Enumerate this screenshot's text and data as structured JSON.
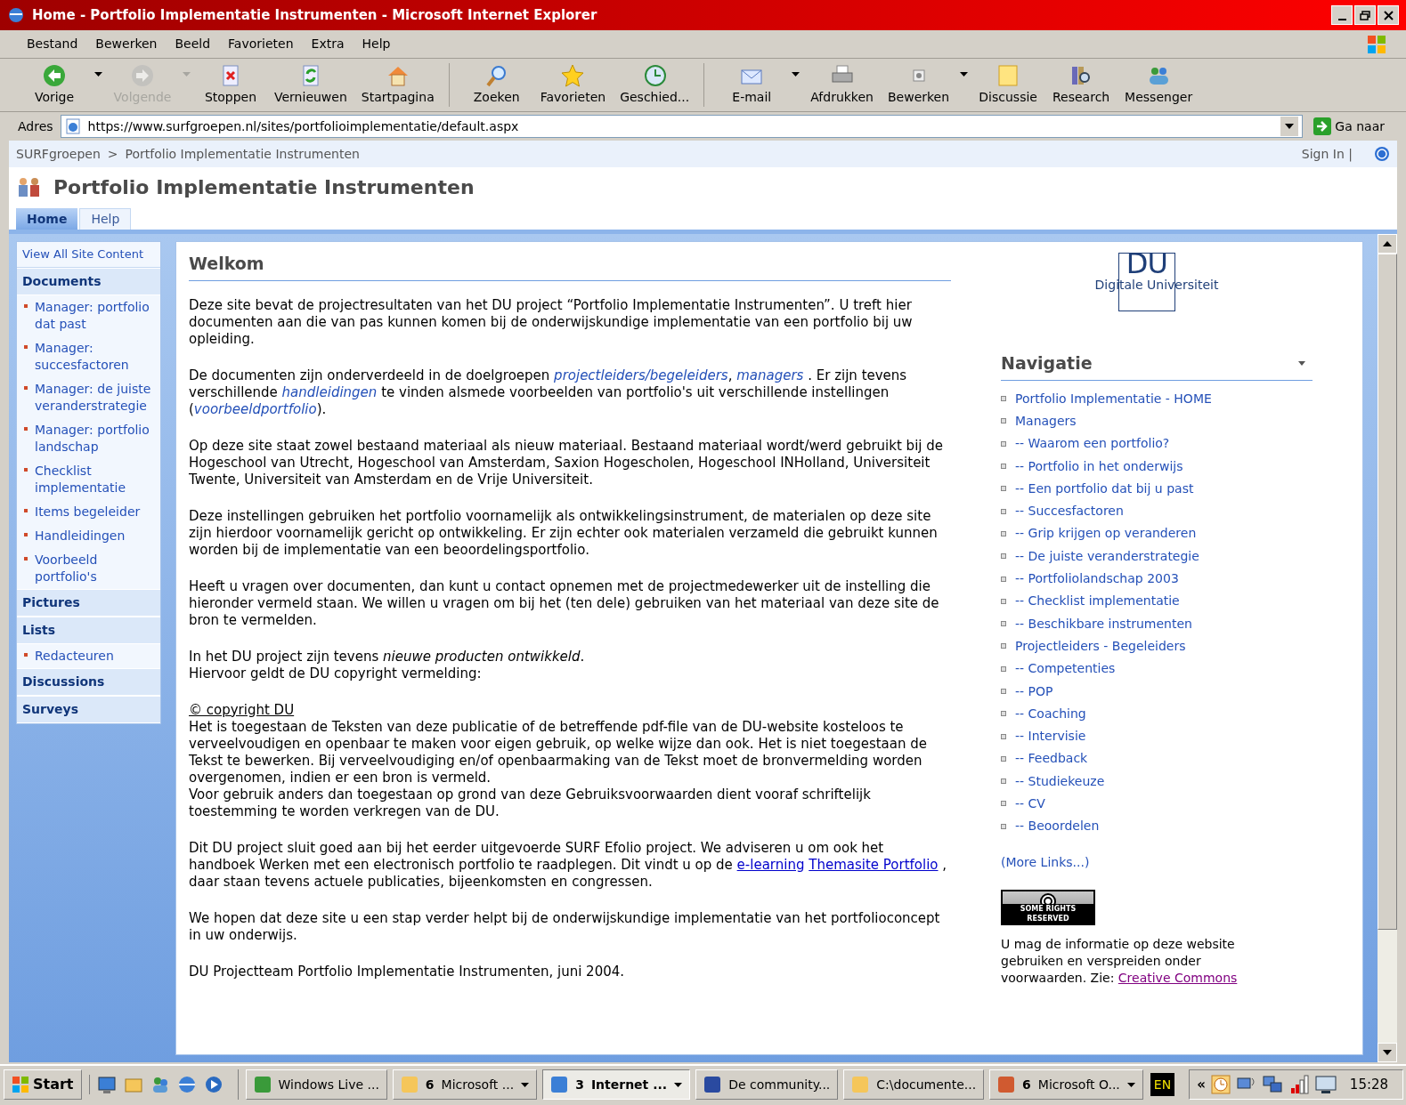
{
  "window": {
    "title": "Home - Portfolio Implementatie Instrumenten - Microsoft Internet Explorer"
  },
  "menu": [
    "Bestand",
    "Bewerken",
    "Beeld",
    "Favorieten",
    "Extra",
    "Help"
  ],
  "toolbar": [
    {
      "label": "Vorige",
      "disabled": false,
      "dropdown": true
    },
    {
      "label": "Volgende",
      "disabled": true,
      "dropdown": true
    },
    {
      "label": "Stoppen",
      "disabled": false,
      "dropdown": false
    },
    {
      "label": "Vernieuwen",
      "disabled": false,
      "dropdown": false
    },
    {
      "label": "Startpagina",
      "disabled": false,
      "dropdown": false
    },
    {
      "label": "Zoeken",
      "disabled": false,
      "dropdown": false
    },
    {
      "label": "Favorieten",
      "disabled": false,
      "dropdown": false
    },
    {
      "label": "Geschied...",
      "disabled": false,
      "dropdown": false
    },
    {
      "label": "E-mail",
      "disabled": false,
      "dropdown": true
    },
    {
      "label": "Afdrukken",
      "disabled": false,
      "dropdown": false
    },
    {
      "label": "Bewerken",
      "disabled": false,
      "dropdown": true
    },
    {
      "label": "Discussie",
      "disabled": false,
      "dropdown": false
    },
    {
      "label": "Research",
      "disabled": false,
      "dropdown": false
    },
    {
      "label": "Messenger",
      "disabled": false,
      "dropdown": false
    }
  ],
  "address": {
    "label": "Adres",
    "value": "https://www.surfgroepen.nl/sites/portfolioimplementatie/default.aspx",
    "go": "Ga naar"
  },
  "site": {
    "breadcrumb": [
      "SURFgroepen",
      ">",
      "Portfolio Implementatie Instrumenten"
    ],
    "sign_in": "Sign In |",
    "title": "Portfolio Implementatie Instrumenten",
    "tabs": [
      {
        "label": "Home",
        "selected": true
      },
      {
        "label": "Help",
        "selected": false
      }
    ]
  },
  "quick_launch": [
    {
      "kind": "link",
      "label": "View All Site Content"
    },
    {
      "kind": "header",
      "label": "Documents"
    },
    {
      "kind": "item",
      "label": "Manager: portfolio dat past"
    },
    {
      "kind": "item",
      "label": "Manager: succesfactoren"
    },
    {
      "kind": "item",
      "label": "Manager: de juiste veranderstrategie"
    },
    {
      "kind": "item",
      "label": "Manager: portfolio landschap"
    },
    {
      "kind": "item",
      "label": "Checklist implementatie"
    },
    {
      "kind": "item",
      "label": "Items begeleider"
    },
    {
      "kind": "item",
      "label": "Handleidingen"
    },
    {
      "kind": "item",
      "label": "Voorbeeld portfolio's"
    },
    {
      "kind": "header",
      "label": "Pictures"
    },
    {
      "kind": "header",
      "label": "Lists"
    },
    {
      "kind": "item",
      "label": "Redacteuren"
    },
    {
      "kind": "header",
      "label": "Discussions"
    },
    {
      "kind": "header",
      "label": "Surveys"
    }
  ],
  "main": {
    "heading": "Welkom",
    "paragraphs": [
      {
        "parts": [
          {
            "kind": "text",
            "text": "Deze site bevat de projectresultaten van het DU project “Portfolio Implementatie Instrumenten”. U treft hier documenten aan die van pas kunnen komen bij de onderwijskundige implementatie van een portfolio bij uw opleiding."
          }
        ]
      },
      {
        "parts": [
          {
            "kind": "text",
            "text": "De documenten zijn onderverdeeld in de doelgroepen "
          },
          {
            "kind": "link",
            "text": "projectleiders/begeleiders"
          },
          {
            "kind": "text",
            "text": ", "
          },
          {
            "kind": "link",
            "text": "managers"
          },
          {
            "kind": "text",
            "text": " . Er zijn tevens verschillende "
          },
          {
            "kind": "link",
            "text": "handleidingen"
          },
          {
            "kind": "text",
            "text": " te vinden alsmede voorbeelden van portfolio's uit verschillende instellingen ("
          },
          {
            "kind": "link",
            "text": "voorbeeldportfolio"
          },
          {
            "kind": "text",
            "text": ")."
          }
        ]
      },
      {
        "parts": [
          {
            "kind": "text",
            "text": "Op deze site staat zowel bestaand materiaal als nieuw materiaal. Bestaand materiaal wordt/werd gebruikt bij de Hogeschool van Utrecht, Hogeschool van Amsterdam, Saxion Hogescholen, Hogeschool INHolland, Universiteit Twente, Universiteit van Amsterdam en de Vrije Universiteit."
          }
        ]
      },
      {
        "parts": [
          {
            "kind": "text",
            "text": "Deze instellingen gebruiken het portfolio voornamelijk als ontwikkelingsinstrument, de materialen op deze site zijn hierdoor voornamelijk gericht op ontwikkeling. Er zijn echter ook materialen verzameld die gebruikt kunnen worden bij de implementatie van een beoordelingsportfolio."
          }
        ]
      },
      {
        "parts": [
          {
            "kind": "text",
            "text": "Heeft u vragen over documenten, dan kunt u contact opnemen met de projectmedewerker uit de instelling die hieronder vermeld staan. We willen u vragen om bij het (ten dele) gebruiken van het materiaal van deze site de bron te vermelden."
          }
        ]
      },
      {
        "parts": [
          {
            "kind": "text",
            "text": "In het DU project zijn tevens *nieuwe producten ontwikkeld*."
          },
          {
            "kind": "text",
            "text": "Hiervoor geldt de DU copyright vermelding:",
            "newline": true
          }
        ]
      },
      {
        "parts": [
          {
            "kind": "underline",
            "text": "© copyright DU"
          },
          {
            "kind": "text",
            "text": "Het is toegestaan de Teksten van deze publicatie of de betreffende pdf-file van de DU-website kosteloos te verveelvoudigen en openbaar te maken voor eigen gebruik, op welke wijze dan ook. Het is niet toegestaan de Tekst te bewerken. Bij verveelvoudiging en/of openbaarmaking van de Tekst moet de bronvermelding worden overgenomen, indien er een bron is vermeld.",
            "newline": true
          },
          {
            "kind": "text",
            "text": "Voor gebruik anders dan toegestaan op grond van deze Gebruiksvoorwaarden dient vooraf schriftelijk toestemming te worden verkregen van de DU.",
            "newline": true
          }
        ]
      },
      {
        "parts": [
          {
            "kind": "text",
            "text": "Dit DU project sluit goed aan bij het eerder uitgevoerde SURF Efolio project. We adviseren u om ook het handboek Werken met een electronisch portfolio te raadplegen. Dit vindt u op de  "
          },
          {
            "kind": "weblink",
            "text": "e-learning"
          },
          {
            "kind": "weblink",
            "text": "Themasite Portfolio"
          },
          {
            "kind": "text",
            "text": " , daar staan tevens actuele publicaties, bijeenkomsten en congressen."
          }
        ]
      },
      {
        "parts": [
          {
            "kind": "text",
            "text": "We hopen dat deze site u een stap verder helpt bij de onderwijskundige implementatie van het portfolioconcept in uw onderwijs."
          }
        ]
      },
      {
        "parts": [
          {
            "kind": "text",
            "text": "DU Projectteam Portfolio Implementatie Instrumenten, juni 2004."
          }
        ]
      }
    ]
  },
  "logo": {
    "mark": "DU",
    "name": "Digitale Universiteit"
  },
  "navigation": {
    "title": "Navigatie",
    "items": [
      "Portfolio Implementatie - HOME",
      "Managers",
      "-- Waarom een portfolio?",
      "-- Portfolio in het onderwijs",
      "-- Een portfolio dat bij u past",
      "-- Succesfactoren",
      "-- Grip krijgen op veranderen",
      "-- De juiste veranderstrategie",
      "-- Portfoliolandschap 2003",
      "-- Checklist implementatie",
      "-- Beschikbare instrumenten",
      "Projectleiders - Begeleiders",
      "-- Competenties",
      "-- POP",
      "-- Coaching",
      "-- Intervisie",
      "-- Feedback",
      "-- Studiekeuze",
      "-- CV",
      "-- Beoordelen"
    ],
    "more": "(More Links...)"
  },
  "license": {
    "badge": "SOME RIGHTS RESERVED",
    "text": "U mag de informatie op deze website gebruiken en verspreiden onder voorwaarden. Zie: ",
    "link": "Creative Commons"
  },
  "taskbar": {
    "start": "Start",
    "tasks": [
      {
        "label": "Windows Live ...",
        "selected": false,
        "dropdown": false
      },
      {
        "label": "Microsoft ...",
        "count": "6",
        "selected": false,
        "dropdown": true
      },
      {
        "label": "Internet ...",
        "count": "3",
        "selected": true,
        "dropdown": true
      },
      {
        "label": "De community...",
        "selected": false,
        "dropdown": false
      },
      {
        "label": "C:\\documente...",
        "selected": false,
        "dropdown": false
      },
      {
        "label": "Microsoft O...",
        "count": "6",
        "selected": false,
        "dropdown": true
      }
    ],
    "language": "EN",
    "expand": "«",
    "clock": "15:28"
  }
}
